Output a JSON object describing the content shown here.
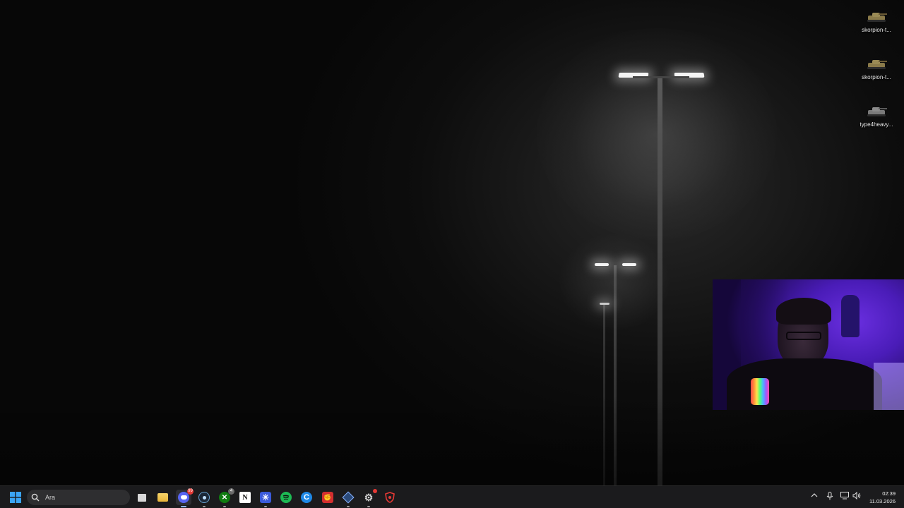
{
  "desktop": {
    "icons": [
      {
        "label": "skorpion-t...",
        "icon": "tank-icon",
        "color": "#8a7a4a"
      },
      {
        "label": "skorpion-t...",
        "icon": "tank-icon",
        "color": "#8a7a4a"
      },
      {
        "label": "type4heavy...",
        "icon": "tank-icon",
        "color": "#7a7a7a"
      }
    ]
  },
  "taskbar": {
    "search": {
      "placeholder": "Ara"
    },
    "apps": [
      {
        "name": "task-view",
        "icon": "task-view-icon"
      },
      {
        "name": "file-explorer",
        "icon": "folder-icon",
        "color": "#f2c94c"
      },
      {
        "name": "discord",
        "icon": "discord-icon",
        "color": "#5865f2",
        "badge": "99",
        "active": true
      },
      {
        "name": "steam",
        "icon": "steam-icon",
        "color": "#1b2838"
      },
      {
        "name": "xbox",
        "icon": "xbox-icon",
        "color": "#107c10",
        "badge": "4"
      },
      {
        "name": "notion",
        "icon": "notion-icon",
        "color": "#ffffff"
      },
      {
        "name": "perplexity",
        "icon": "snowflake-icon",
        "color": "#3b5bdb"
      },
      {
        "name": "spotify",
        "icon": "spotify-icon",
        "color": "#1db954"
      },
      {
        "name": "copilot",
        "icon": "c-icon",
        "color": "#1e88e5"
      },
      {
        "name": "red-app",
        "icon": "fist-icon",
        "color": "#d32f2f"
      },
      {
        "name": "wot-launcher",
        "icon": "wargaming-icon",
        "color": "#5a8fd8"
      },
      {
        "name": "settings-app",
        "icon": "gear-icon",
        "color": "#cfcfcf",
        "badge": ""
      },
      {
        "name": "shield-app",
        "icon": "shield-icon",
        "color": "#c62828"
      }
    ]
  },
  "tray": {
    "time": "02:39",
    "date": "11.03.2026"
  }
}
